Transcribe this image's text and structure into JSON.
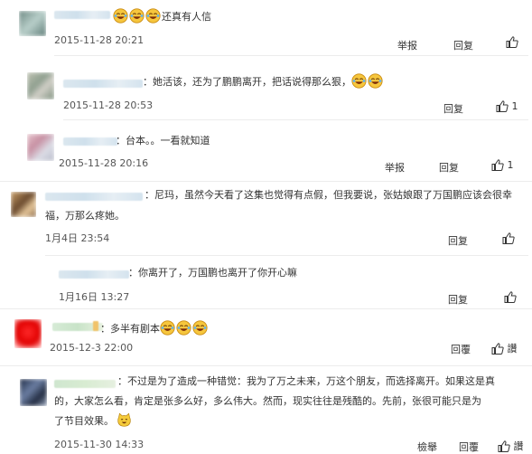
{
  "icons": {
    "like": "thumbs-up-icon",
    "emoji": "laugh-cry-emoji-icon",
    "cat": "cat-emoji-icon"
  },
  "comments": [
    {
      "text": "还真有人信",
      "time": "2015-11-28 20:21",
      "report": "举报",
      "reply": "回复",
      "likes": ""
    },
    {
      "text": "：她活该，还为了鹏鹏离开，把话说得那么狠，",
      "time": "2015-11-28 20:53",
      "reply": "回复",
      "likes": "1"
    },
    {
      "text": "：台本。。一看就知道",
      "time": "2015-11-28 20:16",
      "report": "举报",
      "reply": "回复",
      "likes": "1"
    },
    {
      "text_line1": "：尼玛，虽然今天看了这集也觉得有点假，但我要说，张姑娘跟了万国鹏应该会很幸",
      "text_line2": "福，万那么疼她。",
      "time": "1月4日 23:54",
      "reply": "回复",
      "likes": ""
    },
    {
      "text": "：你离开了，万国鹏也离开了你开心嘛",
      "time": "1月16日 13:27",
      "reply": "回复",
      "likes": ""
    },
    {
      "text": "：多半有剧本",
      "time": "2015-12-3 22:00",
      "reply": "回覆",
      "likes": "讚"
    },
    {
      "text_line1": "：不过是为了造成一种错觉：我为了万之未来，万这个朋友，而选择离开。如果这是真",
      "text_line2": "的，大家怎么看，肯定是张多么好，多么伟大。然而，现实往往是残酷的。先前，张很可能只是为",
      "text_line3": "了节目效果。",
      "time": "2015-11-30 14:33",
      "report": "檢舉",
      "reply": "回覆",
      "likes": "讚"
    }
  ]
}
